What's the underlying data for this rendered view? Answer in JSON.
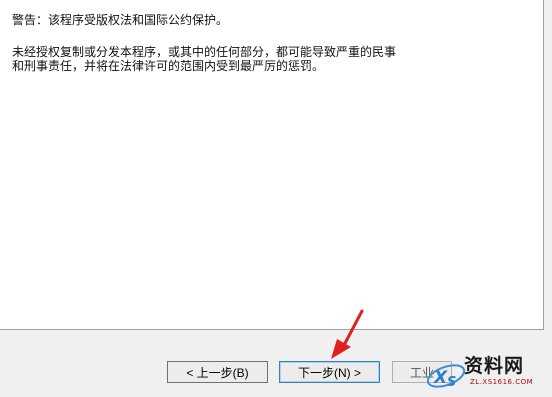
{
  "license": {
    "warning": "警告：该程序受版权法和国际公约保护。",
    "paragraph": "未经授权复制或分发本程序，或其中的任何部分，都可能导致严重的民事和刑事责任，并将在法律许可的范围内受到最严厉的惩罚。"
  },
  "buttons": {
    "back": "< 上一步(B)",
    "next": "下一步(N) >",
    "cancel": "工业"
  },
  "watermark": {
    "brand": "资料网",
    "url": "ZL.XS1616.COM",
    "accent": "#c00000"
  },
  "annotation": {
    "arrow_color": "#e0201e"
  }
}
